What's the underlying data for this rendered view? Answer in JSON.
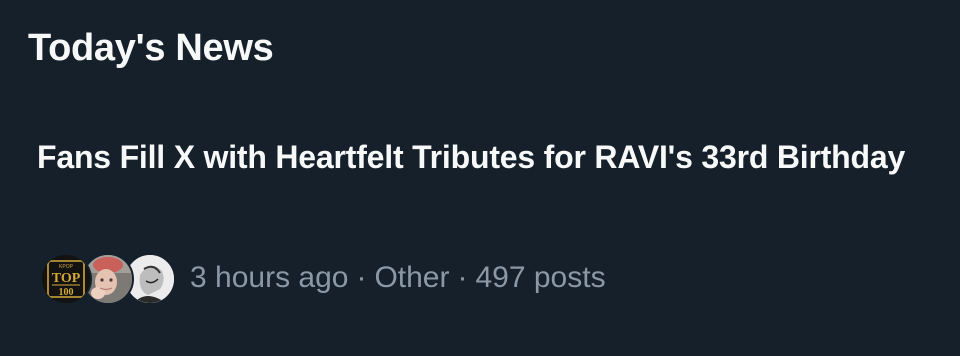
{
  "section": {
    "title": "Today's News"
  },
  "news_item": {
    "headline": "Fans Fill X with Heartfelt Tributes for RAVI's 33rd Birthday",
    "time_ago": "3 hours ago",
    "separator": "·",
    "category": "Other",
    "post_count": "497 posts",
    "avatars": [
      {
        "icon": "top100-logo-avatar",
        "logo_text_small": "KPOP",
        "logo_text_top": "TOP",
        "logo_text_bottom": "100"
      },
      {
        "icon": "user-photo-avatar"
      },
      {
        "icon": "user-sketch-avatar"
      }
    ]
  },
  "colors": {
    "background": "#15202b",
    "text_primary": "#f7f9f9",
    "text_secondary": "#8b98a5",
    "logo_gold": "#d4a93a"
  }
}
